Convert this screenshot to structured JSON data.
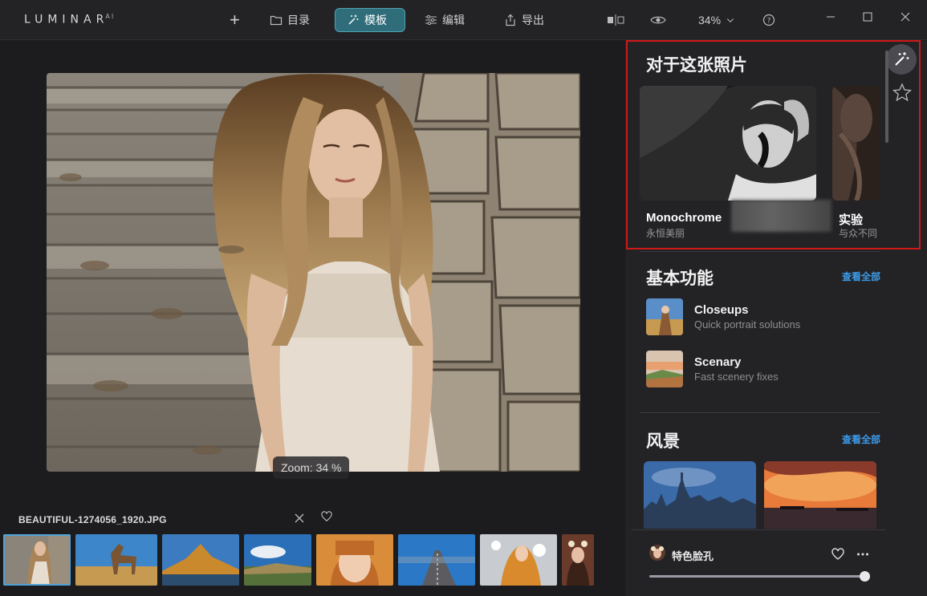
{
  "app": {
    "logo": "LUMINAR",
    "logo_sup": "AI"
  },
  "toolbar": {
    "catalog_label": "目录",
    "templates_label": "模板",
    "edit_label": "编辑",
    "export_label": "导出",
    "zoom_value": "34%"
  },
  "canvas": {
    "zoom_label": "Zoom: 34 %"
  },
  "filmstrip": {
    "filename": "BEAUTIFUL-1274056_1920.JPG",
    "thumbs": 8
  },
  "panel": {
    "for_photo": {
      "title": "对于这张照片",
      "cards": [
        {
          "name": "Monochrome",
          "desc": "永恒美丽"
        },
        {
          "name": "实验",
          "desc": "与众不同"
        }
      ]
    },
    "essentials": {
      "title": "基本功能",
      "see_all": "查看全部",
      "items": [
        {
          "name": "Closeups",
          "desc": "Quick portrait solutions"
        },
        {
          "name": "Scenary",
          "desc": "Fast scenery fixes"
        }
      ]
    },
    "landscape": {
      "title": "风景",
      "see_all": "查看全部"
    },
    "bottom": {
      "name": "特色脸孔",
      "slider_value": 100
    }
  },
  "colors": {
    "accent": "#2f6d7a",
    "link": "#3d9be9",
    "highlight": "#d01818"
  }
}
